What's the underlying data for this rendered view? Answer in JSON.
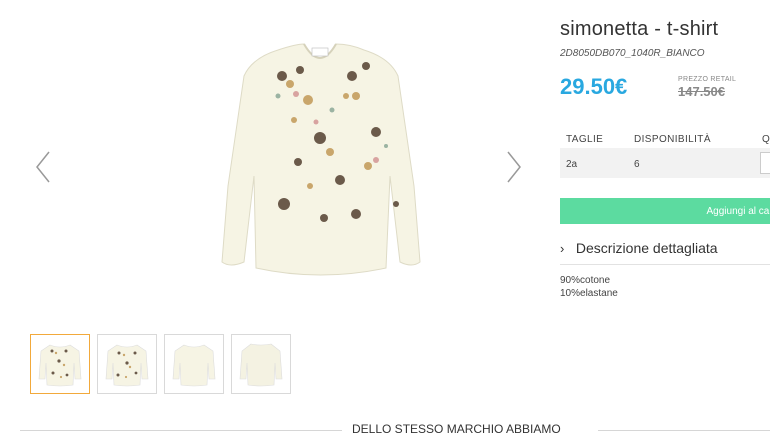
{
  "gallery": {
    "prev_icon": "chevron-left-icon",
    "next_icon": "chevron-right-icon",
    "main_image": "product-image-tshirt-front",
    "thumbnails": [
      {
        "name": "thumb-front",
        "active": true
      },
      {
        "name": "thumb-front-detail",
        "active": false
      },
      {
        "name": "thumb-plain-front",
        "active": false
      },
      {
        "name": "thumb-plain-back",
        "active": false
      }
    ]
  },
  "product": {
    "title": "simonetta - t-shirt",
    "sku": "2D8050DB070_1040R_BIANCO",
    "price": "29.50€",
    "retail_label": "PREZZO RETAIL",
    "retail_price": "147.50€",
    "price_color": "#29a8e0"
  },
  "size_table": {
    "headers": {
      "size": "TAGLIE",
      "availability": "DISPONIBILITÀ",
      "quantity": "Q"
    },
    "rows": [
      {
        "size": "2a",
        "availability": "6"
      }
    ]
  },
  "cart": {
    "button_label": "Aggiungi al carr",
    "button_color": "#5cdba0"
  },
  "description": {
    "toggle_label": "Descrizione dettagliata",
    "lines": [
      "90%cotone",
      "10%elastane"
    ]
  },
  "section": {
    "title": "DELLO STESSO MARCHIO ABBIAMO"
  }
}
